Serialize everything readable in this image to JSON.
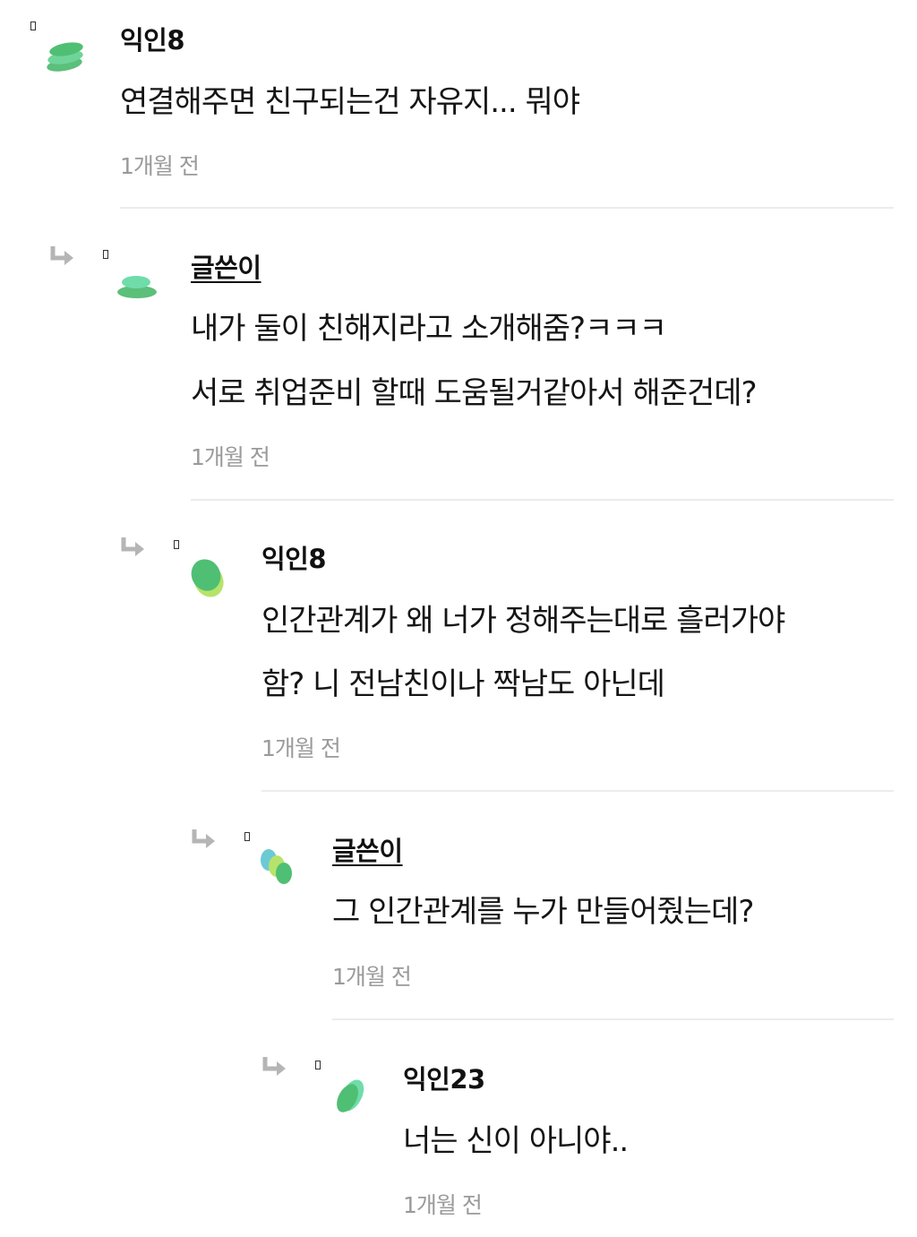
{
  "comments": [
    {
      "author": "익인8",
      "lines": [
        "연결해주면 친구되는건 자유지... 뭐야"
      ],
      "time": "1개월 전"
    },
    {
      "author": "글쓴이",
      "lines": [
        "내가 둘이 친해지라고 소개해줌?ㅋㅋㅋ",
        "서로 취업준비 할때 도움될거같아서 해준건데?"
      ],
      "time": "1개월 전"
    },
    {
      "author": "익인8",
      "lines": [
        "인간관계가 왜 너가 정해주는대로 흘러가야",
        "함? 니 전남친이나 짝남도 아닌데"
      ],
      "time": "1개월 전"
    },
    {
      "author": "글쓴이",
      "lines": [
        "그 인간관계를 누가 만들어줬는데?"
      ],
      "time": "1개월 전"
    },
    {
      "author": "익인23",
      "lines": [
        "너는 신이 아니야.."
      ],
      "time": "1개월 전"
    }
  ],
  "colors": {
    "avatar_green": "#5cbf7a",
    "avatar_mint": "#6fdcaa",
    "avatar_lime": "#b6e36b",
    "avatar_teal": "#6cc9d6",
    "divider": "#ececec",
    "timestamp": "#9a9a9a",
    "reply_arrow": "#b5b5b5"
  },
  "icons": {
    "reply": "reply-arrow-icon",
    "marker": "small-rectangle-marker"
  }
}
